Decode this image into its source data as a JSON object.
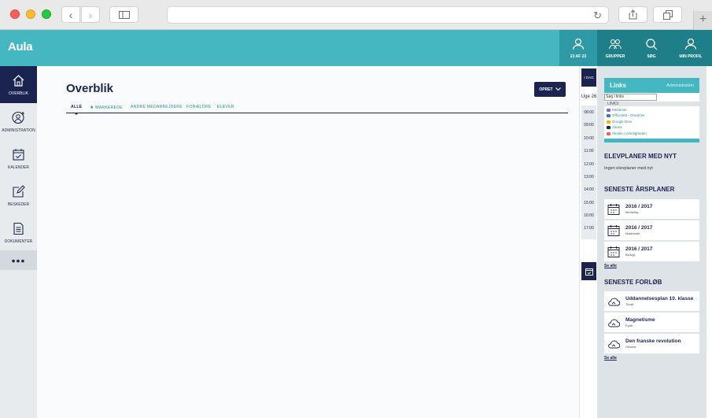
{
  "app": {
    "logo": "Aula"
  },
  "topbar": {
    "profile_label": "23 AF 23",
    "groups_label": "GRUPPER",
    "search_label": "SØG",
    "myprofile_label": "MIN PROFIL"
  },
  "sidebar": {
    "items": [
      {
        "label": "OVERBLIK",
        "icon": "home-icon"
      },
      {
        "label": "ADMINISTRATION",
        "icon": "admin-icon"
      },
      {
        "label": "KALENDER",
        "icon": "calendar-icon"
      },
      {
        "label": "BESKEDER",
        "icon": "edit-icon"
      },
      {
        "label": "DOKUMENTER",
        "icon": "document-icon"
      }
    ],
    "more": "•••"
  },
  "main": {
    "title": "Overblik",
    "create_label": "OPRET",
    "tabs": [
      {
        "label": "ALLE"
      },
      {
        "label": "MARKEREDE"
      },
      {
        "label": "ANDRE MEDARBEJDERE"
      },
      {
        "label": "FORÆLDRE"
      },
      {
        "label": "ELEVER"
      }
    ]
  },
  "calendar": {
    "today_label": "I DAG",
    "week_label": "Uge 26",
    "hours": [
      "08:00",
      "09:00",
      "10:00",
      "11:00",
      "12:00",
      "13:00",
      "14:00",
      "15:00",
      "16:00",
      "17:00"
    ]
  },
  "links": {
    "title": "Links",
    "admin_label": "Administration",
    "search_value": "Søg i links",
    "section_label": "LINKS",
    "items": [
      {
        "label": "Meebook",
        "color": "#7c6ad6"
      },
      {
        "label": "Office365 - Onedrive",
        "color": "#2b7cd3"
      },
      {
        "label": "Google Drev",
        "color": "#f4b400"
      },
      {
        "label": "Alinea",
        "color": "#1b2450"
      },
      {
        "label": "Skolen i virkeligheden",
        "color": "#e8674a"
      }
    ]
  },
  "elevplaner": {
    "title": "ELEVPLANER MED NYT",
    "empty_text": "Ingen elevplaner med nyt"
  },
  "aarsplaner": {
    "title": "SENESTE ÅRSPLANER",
    "items": [
      {
        "title": "2016 / 2017",
        "subject": "Mediefag"
      },
      {
        "title": "2016 / 2017",
        "subject": "Matematik"
      },
      {
        "title": "2016 / 2017",
        "subject": "Biologi"
      }
    ],
    "see_all": "Se alle"
  },
  "forloeb": {
    "title": "SENESTE FORLØB",
    "items": [
      {
        "title": "Uddannelsesplan 10. klasse",
        "subject": "Tilvalt"
      },
      {
        "title": "Magnetisme",
        "subject": "Fysik"
      },
      {
        "title": "Den franske revolution",
        "subject": "Historie"
      }
    ],
    "see_all": "Se alle"
  },
  "colors": {
    "accent": "#45b7c1",
    "navy": "#1b2450",
    "link": "#2e8e98"
  }
}
